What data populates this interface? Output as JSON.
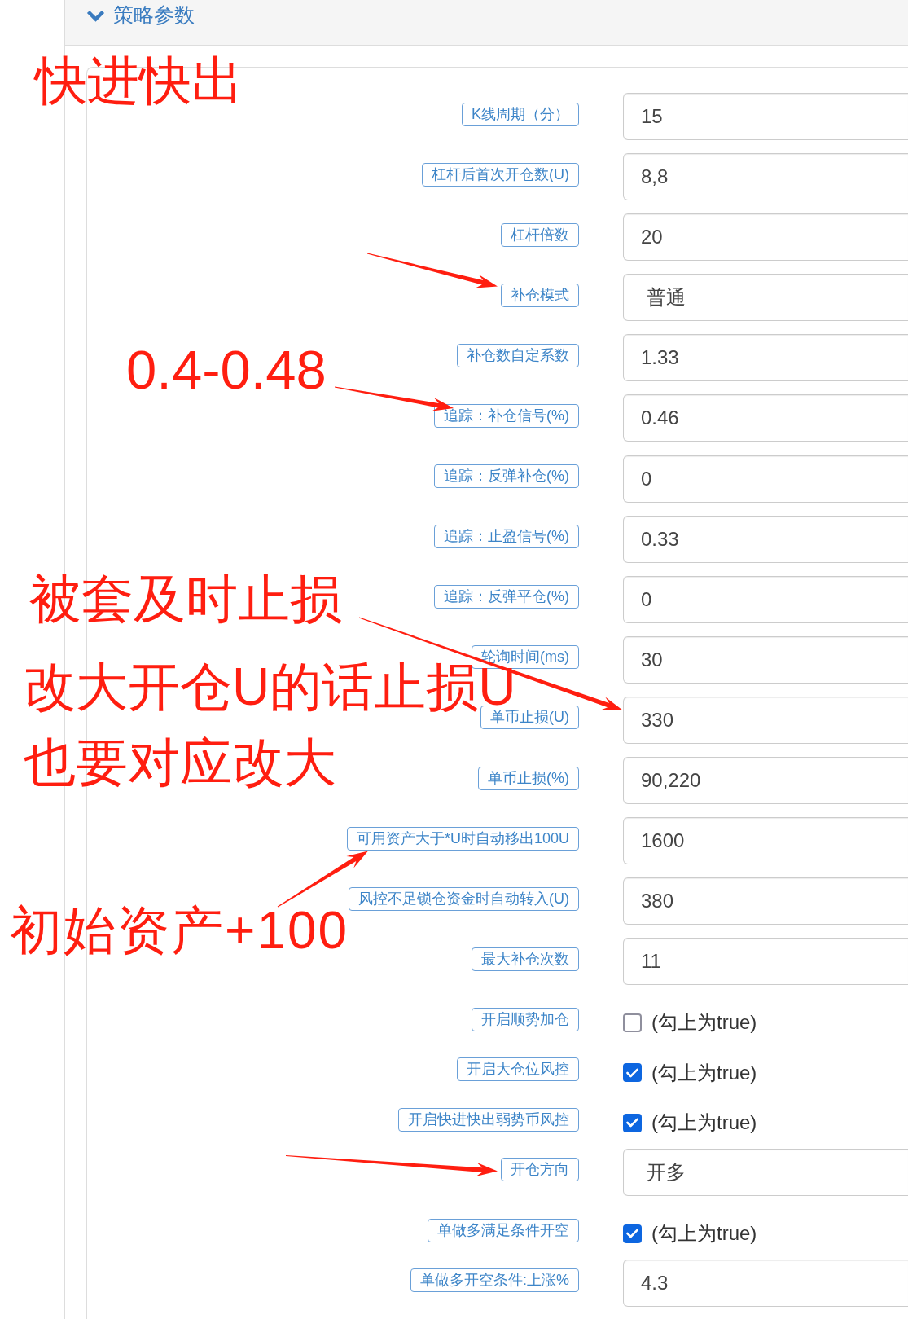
{
  "panel": {
    "title": "策略参数",
    "expanded": true
  },
  "params": [
    {
      "kind": "input",
      "label": "K线周期（分）",
      "value": "15"
    },
    {
      "kind": "input",
      "label": "杠杆后首次开仓数(U)",
      "value": "8,8"
    },
    {
      "kind": "input",
      "label": "杠杆倍数",
      "value": "20"
    },
    {
      "kind": "select",
      "label": "补仓模式",
      "value": "普通"
    },
    {
      "kind": "input",
      "label": "补仓数自定系数",
      "value": "1.33"
    },
    {
      "kind": "input",
      "label": "追踪：补仓信号(%)",
      "value": "0.46"
    },
    {
      "kind": "input",
      "label": "追踪：反弹补仓(%)",
      "value": "0"
    },
    {
      "kind": "input",
      "label": "追踪：止盈信号(%)",
      "value": "0.33"
    },
    {
      "kind": "input",
      "label": "追踪：反弹平仓(%)",
      "value": "0"
    },
    {
      "kind": "input",
      "label": "轮询时间(ms)",
      "value": "30"
    },
    {
      "kind": "input",
      "label": "单币止损(U)",
      "value": "330"
    },
    {
      "kind": "input",
      "label": "单币止损(%)",
      "value": "90,220"
    },
    {
      "kind": "input",
      "label": "可用资产大于*U时自动移出100U",
      "value": "1600"
    },
    {
      "kind": "input",
      "label": "风控不足锁仓资金时自动转入(U)",
      "value": "380"
    },
    {
      "kind": "input",
      "label": "最大补仓次数",
      "value": "11"
    },
    {
      "kind": "checkbox",
      "label": "开启顺势加仓",
      "checked": false,
      "text": "(勾上为true)"
    },
    {
      "kind": "checkbox",
      "label": "开启大仓位风控",
      "checked": true,
      "text": "(勾上为true)"
    },
    {
      "kind": "checkbox",
      "label": "开启快进快出弱势币风控",
      "checked": true,
      "text": "(勾上为true)"
    },
    {
      "kind": "select",
      "label": "开仓方向",
      "value": "开多"
    },
    {
      "kind": "checkbox",
      "label": "单做多满足条件开空",
      "checked": true,
      "text": "(勾上为true)"
    },
    {
      "kind": "input",
      "label": "单做多开空条件:上涨%",
      "value": "4.3"
    }
  ],
  "annotations": [
    {
      "lines": [
        "快进快出"
      ]
    },
    {
      "lines": [
        "0.4-0.48"
      ]
    },
    {
      "lines": [
        "被套及时止损"
      ]
    },
    {
      "lines": [
        "改大开仓U的话止损U",
        "也要对应改大"
      ]
    },
    {
      "lines": [
        "初始资产+100"
      ]
    }
  ]
}
